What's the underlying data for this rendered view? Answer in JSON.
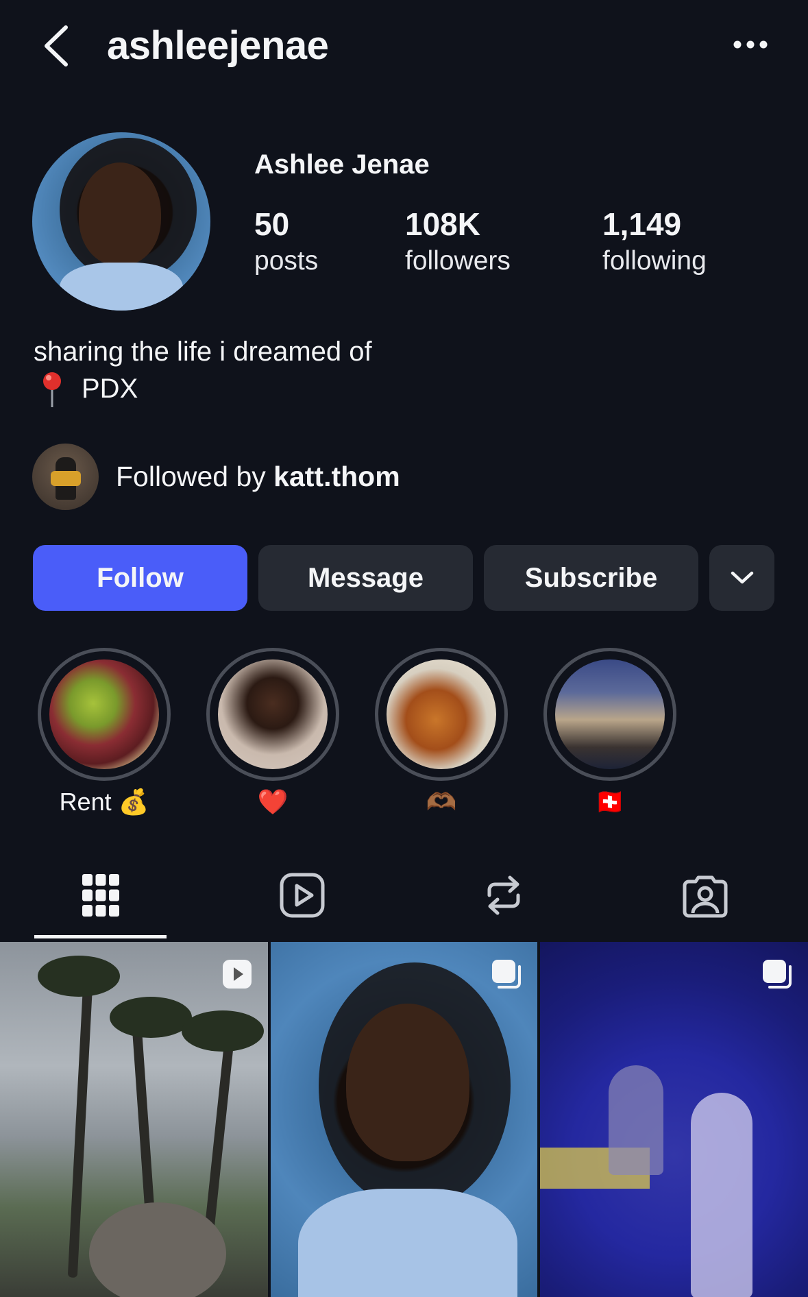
{
  "header": {
    "username": "ashleejenae"
  },
  "profile": {
    "display_name": "Ashlee Jenae",
    "stats": {
      "posts_count": "50",
      "posts_label": "posts",
      "followers_count": "108K",
      "followers_label": "followers",
      "following_count": "1,149",
      "following_label": "following"
    },
    "bio": "sharing the life i dreamed of",
    "location": "PDX",
    "followed_by_prefix": "Followed by ",
    "followed_by_user": "katt.thom"
  },
  "actions": {
    "follow_label": "Follow",
    "message_label": "Message",
    "subscribe_label": "Subscribe"
  },
  "highlights": [
    {
      "label": "Rent 💰"
    },
    {
      "label": "❤️"
    },
    {
      "label": "🫶🏾"
    },
    {
      "label": "🇨🇭"
    }
  ],
  "tabs": [
    {
      "icon": "grid-icon",
      "active": true
    },
    {
      "icon": "reels-icon",
      "active": false
    },
    {
      "icon": "reposts-icon",
      "active": false
    },
    {
      "icon": "tagged-icon",
      "active": false
    }
  ],
  "posts": [
    {
      "type": "reel",
      "badge_icon": "reel-badge-icon"
    },
    {
      "type": "carousel",
      "badge_icon": "carousel-badge-icon"
    },
    {
      "type": "carousel",
      "badge_icon": "carousel-badge-icon"
    }
  ],
  "colors": {
    "background": "#0f121b",
    "follow_button": "#4a5df9",
    "secondary_button": "#262a33",
    "text": "#f4f5f7"
  }
}
